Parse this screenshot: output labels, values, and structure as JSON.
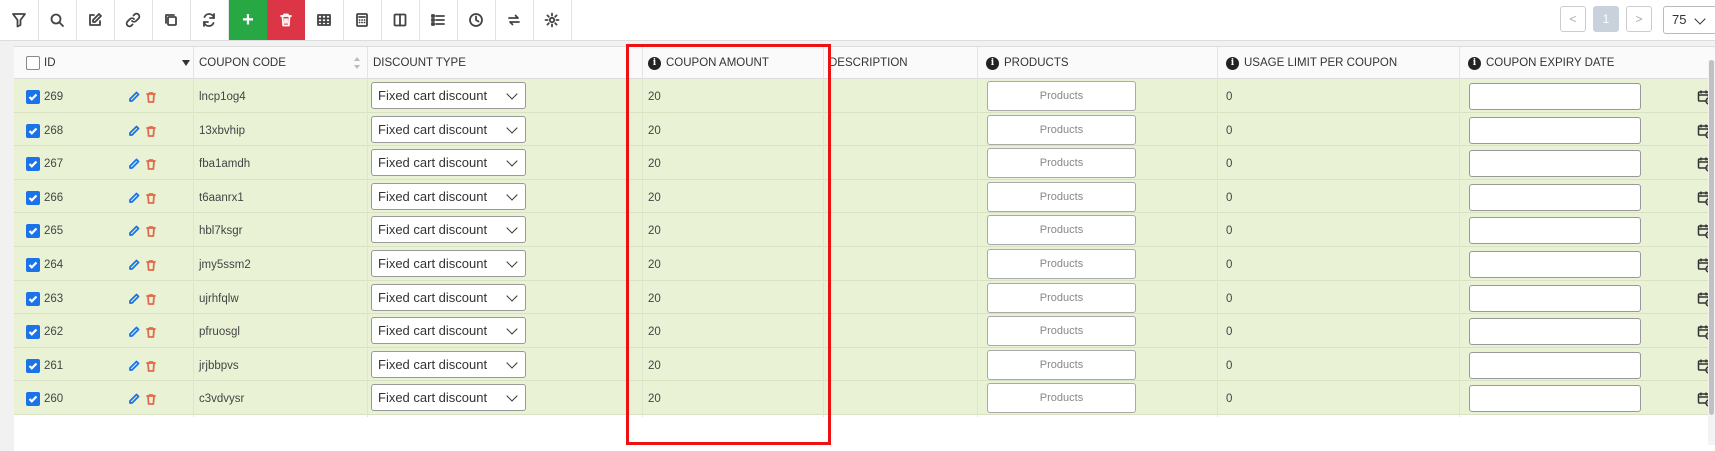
{
  "toolbar": {
    "buttons": [
      {
        "name": "filter-icon"
      },
      {
        "name": "search-icon"
      },
      {
        "name": "edit-icon"
      },
      {
        "name": "link-icon"
      },
      {
        "name": "duplicate-icon"
      },
      {
        "name": "refresh-icon"
      },
      {
        "name": "add-icon",
        "label": "+",
        "color": "#28a745"
      },
      {
        "name": "delete-icon",
        "color": "#dc3545"
      },
      {
        "name": "table-icon"
      },
      {
        "name": "calculator-icon"
      },
      {
        "name": "columns-icon"
      },
      {
        "name": "list-icon"
      },
      {
        "name": "history-icon"
      },
      {
        "name": "swap-icon"
      },
      {
        "name": "settings-icon"
      }
    ]
  },
  "pagination": {
    "prev": "<",
    "current": "1",
    "next": ">",
    "per_page": "75"
  },
  "table": {
    "headers": {
      "id": "ID",
      "coupon_code": "COUPON CODE",
      "discount_type": "DISCOUNT TYPE",
      "coupon_amount": "COUPON AMOUNT",
      "description": "DESCRIPTION",
      "products": "PRODUCTS",
      "usage_limit": "USAGE LIMIT PER COUPON",
      "expiry_date": "COUPON EXPIRY DATE"
    },
    "products_button_label": "Products",
    "rows": [
      {
        "id": "269",
        "code": "lncp1og4",
        "discount_type": "Fixed cart discount",
        "amount": "20",
        "description": "",
        "usage_limit": "0",
        "expiry": ""
      },
      {
        "id": "268",
        "code": "13xbvhip",
        "discount_type": "Fixed cart discount",
        "amount": "20",
        "description": "",
        "usage_limit": "0",
        "expiry": ""
      },
      {
        "id": "267",
        "code": "fba1amdh",
        "discount_type": "Fixed cart discount",
        "amount": "20",
        "description": "",
        "usage_limit": "0",
        "expiry": ""
      },
      {
        "id": "266",
        "code": "t6aanrx1",
        "discount_type": "Fixed cart discount",
        "amount": "20",
        "description": "",
        "usage_limit": "0",
        "expiry": ""
      },
      {
        "id": "265",
        "code": "hbl7ksgr",
        "discount_type": "Fixed cart discount",
        "amount": "20",
        "description": "",
        "usage_limit": "0",
        "expiry": ""
      },
      {
        "id": "264",
        "code": "jmy5ssm2",
        "discount_type": "Fixed cart discount",
        "amount": "20",
        "description": "",
        "usage_limit": "0",
        "expiry": ""
      },
      {
        "id": "263",
        "code": "ujrhfqlw",
        "discount_type": "Fixed cart discount",
        "amount": "20",
        "description": "",
        "usage_limit": "0",
        "expiry": ""
      },
      {
        "id": "262",
        "code": "pfruosgl",
        "discount_type": "Fixed cart discount",
        "amount": "20",
        "description": "",
        "usage_limit": "0",
        "expiry": ""
      },
      {
        "id": "261",
        "code": "jrjbbpvs",
        "discount_type": "Fixed cart discount",
        "amount": "20",
        "description": "",
        "usage_limit": "0",
        "expiry": ""
      },
      {
        "id": "260",
        "code": "c3vdvysr",
        "discount_type": "Fixed cart discount",
        "amount": "20",
        "description": "",
        "usage_limit": "0",
        "expiry": ""
      }
    ]
  },
  "colors": {
    "row_bg": "#eaf2d6",
    "checkbox": "#1a73e8",
    "edit_icon": "#1a73e8",
    "delete_icon": "#e06c4b",
    "highlight": "#ee1111"
  }
}
